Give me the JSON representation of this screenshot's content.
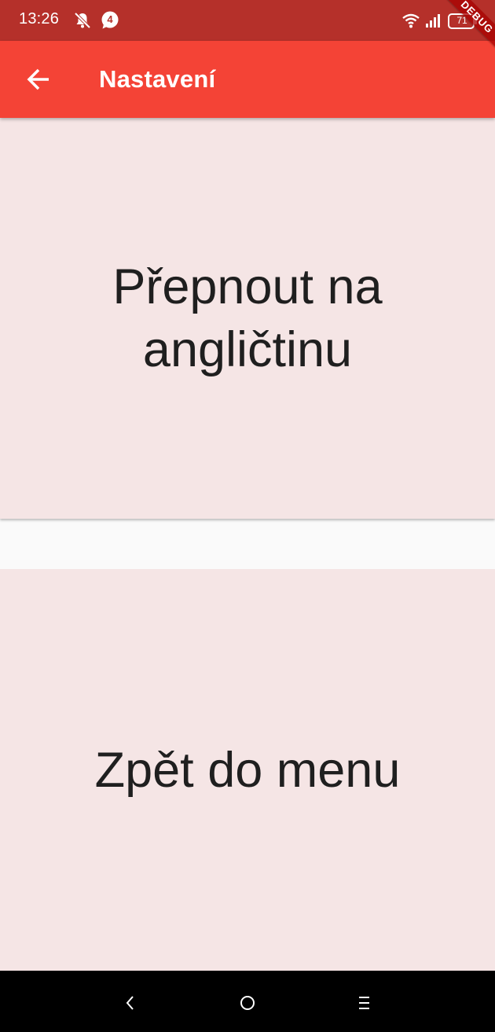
{
  "status_bar": {
    "time": "13:26",
    "notification_count": "4",
    "battery_level": "71",
    "icons": [
      "bell-off-icon",
      "message-badge-icon",
      "wifi-icon",
      "signal-icon",
      "battery-icon"
    ]
  },
  "debug_banner": "DEBUG",
  "app_bar": {
    "back_icon": "arrow-left-icon",
    "title": "Nastavení"
  },
  "buttons": [
    {
      "label": "Přepnout na angličtinu"
    },
    {
      "label": "Zpět do menu"
    }
  ],
  "nav_bar": {
    "icons": [
      "chevron-left-icon",
      "circle-home-icon",
      "menu-lines-icon"
    ]
  },
  "colors": {
    "status_bar": "#b5302a",
    "app_bar": "#f44336",
    "button_background": "#f5e5e5",
    "page_background": "#fafafa",
    "nav_bar": "#000000"
  }
}
